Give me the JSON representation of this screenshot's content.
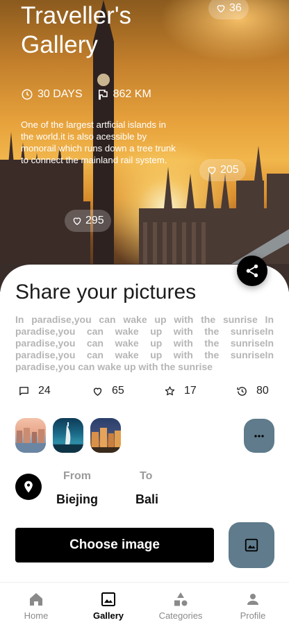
{
  "hero": {
    "title": "Traveller's Gallery",
    "top_like_count": "36",
    "days": "30 DAYS",
    "distance": "862 KM",
    "description": "One of the largest artficial islands in the world.it is also acessible by monorail which runs down a tree trunk to connect the mainland rail system.",
    "like_right": "205",
    "like_left": "295"
  },
  "sheet": {
    "title": "Share your pictures",
    "description": "In paradise,you can wake up with the sunrise In paradise,you can wake up with the sunriseIn paradise,you can wake up with the sunriseIn paradise,you can wake up with the sunriseIn paradise,you can wake up with the sunrise",
    "metrics": {
      "comments": "24",
      "likes": "65",
      "stars": "17",
      "history": "80"
    },
    "route": {
      "from_label": "From",
      "from_value": "Biejing",
      "to_label": "To",
      "to_value": "Bali"
    },
    "choose_button": "Choose image"
  },
  "nav": {
    "items": [
      {
        "label": "Home"
      },
      {
        "label": "Gallery"
      },
      {
        "label": "Categories"
      },
      {
        "label": "Profile"
      }
    ],
    "active": "Gallery"
  },
  "colors": {
    "accent": "#5f7b8c",
    "primary": "#000000",
    "muted_text": "#b5b5b5"
  },
  "icons": {
    "days": "clock-icon",
    "distance": "flag-icon",
    "like": "heart-outline-icon",
    "share": "share-icon",
    "comments": "comment-icon",
    "stars": "star-outline-icon",
    "history": "history-icon",
    "more": "more-horizontal-icon",
    "pin": "location-pin-icon",
    "image": "image-icon"
  }
}
